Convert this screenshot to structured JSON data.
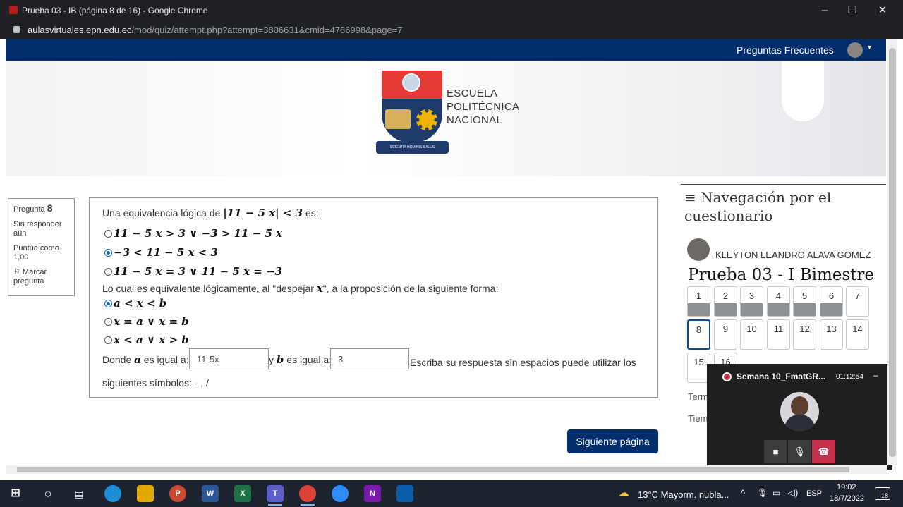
{
  "browser": {
    "window_title": "Prueba 03 - IB (página 8 de 16) - Google Chrome",
    "url_host": "aulasvirtuales.epn.edu.ec",
    "url_path": "/mod/quiz/attempt.php?attempt=3806631&cmid=4786998&page=7",
    "minimize": "–",
    "maximize": "☐",
    "close": "✕"
  },
  "site_nav": {
    "faq": "Preguntas Frecuentes",
    "caret": "▾"
  },
  "logo": {
    "line1": "ESCUELA",
    "line2": "POLITÉCNICA",
    "line3": "NACIONAL",
    "motto": "SCIENTIA HOMINIS SALUS"
  },
  "question_info": {
    "label": "Pregunta",
    "number": "8",
    "status": "Sin responder aún",
    "grade": "Puntúa como 1,00",
    "flag": "Marcar pregunta"
  },
  "question": {
    "intro_prefix": "Una equivalencia lógica de",
    "intro_expr": "|11 − 5 x| < 3",
    "intro_suffix": "es:",
    "options1": [
      {
        "text": "11 − 5 x > 3 ∨ −3 > 11 − 5 x",
        "selected": false
      },
      {
        "text": "−3 < 11 − 5 x < 3",
        "selected": true
      },
      {
        "text": "11 − 5 x = 3 ∨ 11 − 5 x = −3",
        "selected": false
      }
    ],
    "middle_prefix": "Lo cual es equivalente lógicamente, al \"despejar",
    "middle_var": "x",
    "middle_suffix": "\", a la proposición de la siguiente forma:",
    "options2": [
      {
        "text": "a < x < b",
        "selected": true
      },
      {
        "text": "x = a ∨ x = b",
        "selected": false
      },
      {
        "text": "x < a ∨ x > b",
        "selected": false
      }
    ],
    "donde": "Donde",
    "var_a": "a",
    "es_igual_a": "es igual a:",
    "field_a": "11-5x",
    "y": "y",
    "var_b": "b",
    "es_igual_b": "es igual a:",
    "field_b": "3",
    "instructions": "Escriba su respuesta sin espacios puede utilizar los siguientes símbolos: - , /"
  },
  "next_button": "Siguiente página",
  "quiz_nav": {
    "heading": "Navegación por el cuestionario",
    "menu_icon": "≡",
    "user": "KLEYTON LEANDRO ALAVA GOMEZ",
    "quiz_name": "Prueba 03 - I Bimestre",
    "buttons": [
      {
        "n": "1",
        "answered": true
      },
      {
        "n": "2",
        "answered": true
      },
      {
        "n": "3",
        "answered": true
      },
      {
        "n": "4",
        "answered": true
      },
      {
        "n": "5",
        "answered": true
      },
      {
        "n": "6",
        "answered": true
      },
      {
        "n": "7",
        "answered": false
      },
      {
        "n": "8",
        "answered": false,
        "current": true
      },
      {
        "n": "9",
        "answered": false
      },
      {
        "n": "10",
        "answered": false
      },
      {
        "n": "11",
        "answered": false
      },
      {
        "n": "12",
        "answered": false
      },
      {
        "n": "13",
        "answered": false
      },
      {
        "n": "14",
        "answered": false
      },
      {
        "n": "15",
        "answered": false
      },
      {
        "n": "16",
        "answered": false
      }
    ],
    "finish_partial": "Term",
    "time_partial": "Tiem"
  },
  "teams": {
    "meeting": "Semana 10_FmatGR...",
    "elapsed": "01:12:54",
    "minimize": "–",
    "camera": "■",
    "mic": "🎙",
    "hangup": "☎"
  },
  "taskbar": {
    "weather": "13°C  Mayorm. nubla...",
    "lang": "ESP",
    "time": "19:02",
    "date": "18/7/2022",
    "notif_count": "18"
  },
  "colors": {
    "navbar": "#002e6d",
    "accent": "#0f6cbf",
    "logo_red": "#e53935",
    "teams_hang": "#c4314b"
  }
}
